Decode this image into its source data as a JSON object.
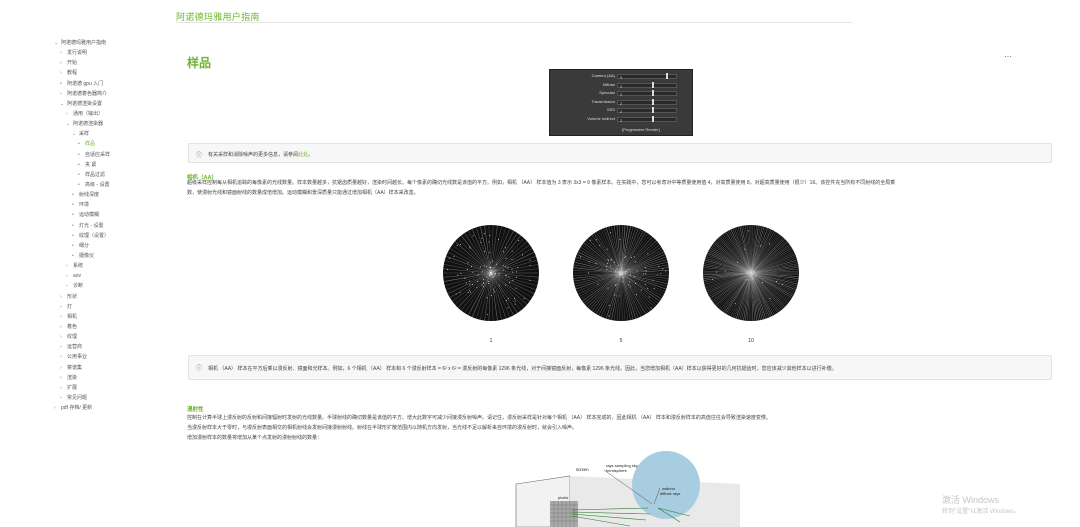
{
  "site_title": "阿诺德玛雅用户指南",
  "sidebar": {
    "items": [
      {
        "label": "阿诺德玛雅用户指南",
        "chev": "⌄",
        "indent": 0,
        "active": false
      },
      {
        "label": "发行说明",
        "chev": "›",
        "indent": 1,
        "active": false
      },
      {
        "label": "开始",
        "chev": "›",
        "indent": 1,
        "active": false
      },
      {
        "label": "教程",
        "chev": "›",
        "indent": 1,
        "active": false
      },
      {
        "label": "阿诺德 gpu 入门",
        "chev": "•",
        "indent": 1,
        "active": false
      },
      {
        "label": "阿诺德着色器简介",
        "chev": "›",
        "indent": 1,
        "active": false
      },
      {
        "label": "阿诺德渲染设置",
        "chev": "⌄",
        "indent": 1,
        "active": false
      },
      {
        "label": "通用（输出）",
        "chev": "›",
        "indent": 2,
        "active": false
      },
      {
        "label": "阿诺德渲染器",
        "chev": "⌄",
        "indent": 2,
        "active": false
      },
      {
        "label": "采样",
        "chev": "⌄",
        "indent": 3,
        "active": false
      },
      {
        "label": "样品",
        "chev": "•",
        "indent": 4,
        "active": true
      },
      {
        "label": "自适应采样",
        "chev": "•",
        "indent": 4,
        "active": false
      },
      {
        "label": "夹 紧",
        "chev": "•",
        "indent": 4,
        "active": false
      },
      {
        "label": "样品过滤",
        "chev": "•",
        "indent": 4,
        "active": false
      },
      {
        "label": "高级 - 设置",
        "chev": "•",
        "indent": 4,
        "active": false
      },
      {
        "label": "射线深度",
        "chev": "•",
        "indent": 3,
        "active": false
      },
      {
        "label": "环境",
        "chev": "•",
        "indent": 3,
        "active": false
      },
      {
        "label": "运动模糊",
        "chev": "•",
        "indent": 3,
        "active": false
      },
      {
        "label": "灯光 - 设置",
        "chev": "•",
        "indent": 3,
        "active": false
      },
      {
        "label": "纹理（设置）",
        "chev": "•",
        "indent": 3,
        "active": false
      },
      {
        "label": "细分",
        "chev": "•",
        "indent": 3,
        "active": false
      },
      {
        "label": "摄像仪",
        "chev": "•",
        "indent": 3,
        "active": false
      },
      {
        "label": "系统",
        "chev": "›",
        "indent": 2,
        "active": false
      },
      {
        "label": "aov",
        "chev": "›",
        "indent": 2,
        "active": false
      },
      {
        "label": "诊断",
        "chev": "›",
        "indent": 2,
        "active": false
      },
      {
        "label": "形状",
        "chev": "›",
        "indent": 1,
        "active": false
      },
      {
        "label": "灯",
        "chev": "›",
        "indent": 1,
        "active": false
      },
      {
        "label": "相机",
        "chev": "›",
        "indent": 1,
        "active": false
      },
      {
        "label": "着色",
        "chev": "›",
        "indent": 1,
        "active": false
      },
      {
        "label": "纹理",
        "chev": "›",
        "indent": 1,
        "active": false
      },
      {
        "label": "运营商",
        "chev": "›",
        "indent": 1,
        "active": false
      },
      {
        "label": "公用事业",
        "chev": "›",
        "indent": 1,
        "active": false
      },
      {
        "label": "菜谱集",
        "chev": "›",
        "indent": 1,
        "active": false
      },
      {
        "label": "渲染",
        "chev": "›",
        "indent": 1,
        "active": false
      },
      {
        "label": "扩展",
        "chev": "›",
        "indent": 1,
        "active": false
      },
      {
        "label": "常见问题",
        "chev": "›",
        "indent": 1,
        "active": false
      },
      {
        "label": "pdf 存档/ 更新",
        "chev": "›",
        "indent": 0,
        "active": false
      }
    ]
  },
  "page": {
    "title": "样品",
    "more": "···"
  },
  "panel": {
    "rows": [
      {
        "label": "Camera (AA)",
        "value": "3",
        "thumb": 0.85
      },
      {
        "label": "Diffuse",
        "value": "2",
        "thumb": 0.6
      },
      {
        "label": "Specular",
        "value": "2",
        "thumb": 0.6
      },
      {
        "label": "Transmission",
        "value": "2",
        "thumb": 0.6
      },
      {
        "label": "SSS",
        "value": "2",
        "thumb": 0.6
      },
      {
        "label": "Volume Indirect",
        "value": "2",
        "thumb": 0.6
      }
    ],
    "button": "[Progressive Render]"
  },
  "note1": {
    "text": "有关采样和消除噪声的更多信息，请参阅",
    "link": "此处",
    "end": "。"
  },
  "section_aa": {
    "heading": "相机（AA）",
    "lines": [
      "超级采样控制每从相机追踪的每像素的光线数量。样本数量越多，抗锯齿质量越好，渲染时间越长。每个像素的确切光线数是该值的平方。例如，相机 （AA） 样本值为 3 表示 3x3 = 9 像素样本。在实践中，您可以考虑对中等质量使用值 4，对高质量使用 8，对超高质量使用（很少）16。该控件充当所有不同射线的全局乘",
      "数，使漫射光线和镜面射线的数量成倍增加。运动模糊和景深质量只能通过增加相机（AA）样本来改善。"
    ]
  },
  "discs": [
    {
      "label": "1",
      "density": 1
    },
    {
      "label": "5",
      "density": 5
    },
    {
      "label": "10",
      "density": 10
    }
  ],
  "note2": {
    "text": "相机 （AA） 样本在平方后乘以漫反射、镜面和光样本。例如，6 个相机 （AA） 样本和 6 个漫反射样本 = 6² x 6² = 漫反射的每像素 1296 条光线，对于间接镜面反射，每像素 1296 条光线。因此，当您增加相机（AA）样本以获得更好的几何抗锯齿时，您应该减少其他样本以进行补偿。"
  },
  "section_diffuse": {
    "heading": "漫射性",
    "lines": [
      "控制在计算半球上漫反射的反射和间接辐射时发射的光线数量。半球射线的确切数量是该值的平方。增大此数字可减少间接漫反射噪声。请记住，漫反射采样是针对每个相机 （AA） 样本完成的，因此相机 （AA） 样本和漫反射样本的高值往往会导致渲染速度变慢。",
      "当漫反射样本大于零时，与漫反射表面相交的相机射线会发射间接漫射射线。射线在半球形扩散范围内以随机方向发射，当光线不足以解析来自环境的漫反射时，就会引入噪声。",
      "增加漫射样本的数量将增加从某个点发射的漫射射线的数量："
    ]
  },
  "diagram": {
    "label_screen": "screen",
    "label_pixels": "pixels",
    "label_rays": "rays sampling sky",
    "label_rays2": "hemisphere",
    "label_indirect": "indirect",
    "label_indirect2": "diffuse rays"
  },
  "watermark": {
    "line1": "激活 Windows",
    "line2": "转到\"设置\"以激活 Windows。"
  }
}
